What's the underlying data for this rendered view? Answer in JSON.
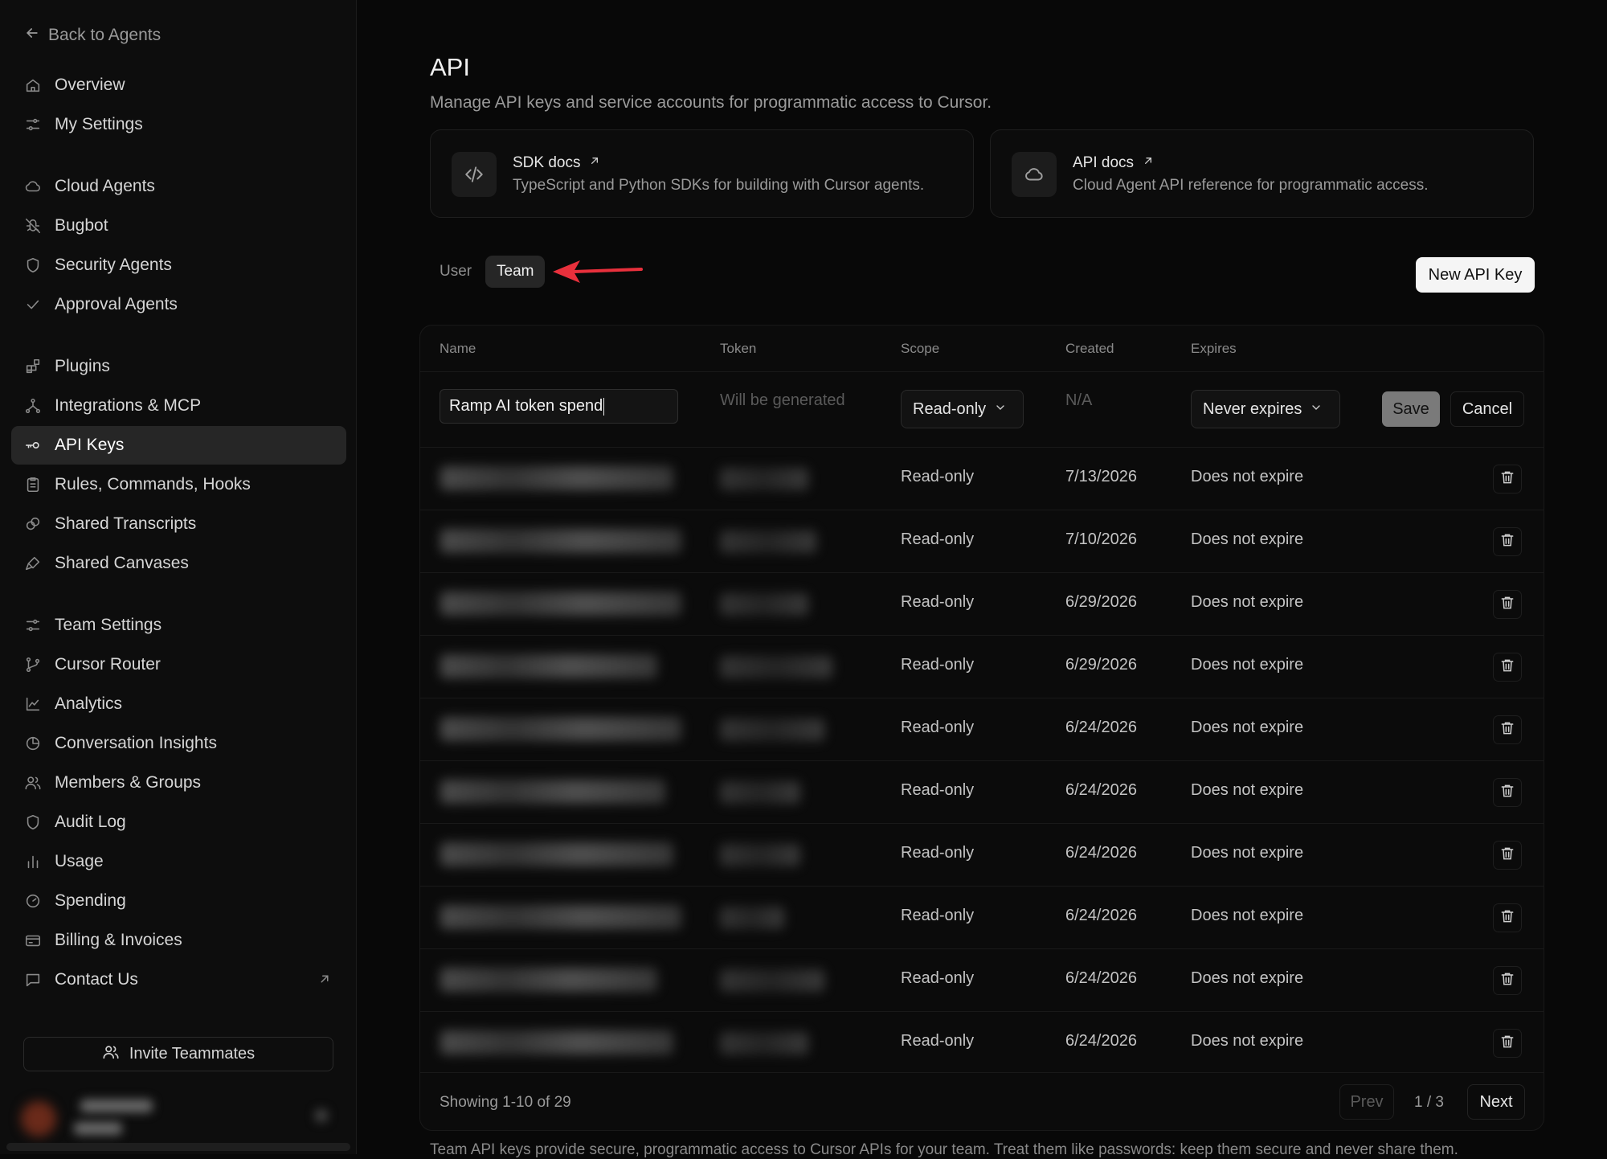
{
  "sidebar": {
    "back_label": "Back to Agents",
    "items": [
      {
        "label": "Overview",
        "icon": "home-icon"
      },
      {
        "label": "My Settings",
        "icon": "sliders-icon"
      },
      {
        "label": "Cloud Agents",
        "icon": "cloud-icon"
      },
      {
        "label": "Bugbot",
        "icon": "bug-off-icon"
      },
      {
        "label": "Security Agents",
        "icon": "shield-icon"
      },
      {
        "label": "Approval Agents",
        "icon": "check-icon"
      },
      {
        "label": "Plugins",
        "icon": "blocks-icon"
      },
      {
        "label": "Integrations & MCP",
        "icon": "network-icon"
      },
      {
        "label": "API Keys",
        "icon": "key-icon"
      },
      {
        "label": "Rules, Commands, Hooks",
        "icon": "clipboard-icon"
      },
      {
        "label": "Shared Transcripts",
        "icon": "chat-share-icon"
      },
      {
        "label": "Shared Canvases",
        "icon": "brush-icon"
      },
      {
        "label": "Team Settings",
        "icon": "sliders-icon"
      },
      {
        "label": "Cursor Router",
        "icon": "branch-icon"
      },
      {
        "label": "Analytics",
        "icon": "line-chart-icon"
      },
      {
        "label": "Conversation Insights",
        "icon": "pie-icon"
      },
      {
        "label": "Members & Groups",
        "icon": "users-icon"
      },
      {
        "label": "Audit Log",
        "icon": "shield-icon"
      },
      {
        "label": "Usage",
        "icon": "bar-chart-icon"
      },
      {
        "label": "Spending",
        "icon": "gauge-icon"
      },
      {
        "label": "Billing & Invoices",
        "icon": "card-icon"
      },
      {
        "label": "Contact Us",
        "icon": "message-icon"
      }
    ],
    "active": "API Keys",
    "invite_label": "Invite Teammates"
  },
  "header": {
    "title": "API",
    "subtitle": "Manage API keys and service accounts for programmatic access to Cursor."
  },
  "cards": [
    {
      "title": "SDK docs",
      "desc": "TypeScript and Python SDKs for building with Cursor agents.",
      "icon": "code-icon"
    },
    {
      "title": "API docs",
      "desc": "Cloud Agent API reference for programmatic access.",
      "icon": "cloud-icon"
    }
  ],
  "toggle": {
    "user": "User",
    "team": "Team",
    "selected": "Team"
  },
  "new_key_label": "New API Key",
  "table": {
    "headers": {
      "name": "Name",
      "token": "Token",
      "scope": "Scope",
      "created": "Created",
      "expires": "Expires"
    },
    "new_row": {
      "name_value": "Ramp AI token spend",
      "token_placeholder": "Will be generated",
      "scope": "Read-only",
      "created": "N/A",
      "expires": "Never expires",
      "save": "Save",
      "cancel": "Cancel"
    },
    "rows": [
      {
        "scope": "Read-only",
        "created": "7/13/2026",
        "expires": "Does not expire"
      },
      {
        "scope": "Read-only",
        "created": "7/10/2026",
        "expires": "Does not expire"
      },
      {
        "scope": "Read-only",
        "created": "6/29/2026",
        "expires": "Does not expire"
      },
      {
        "scope": "Read-only",
        "created": "6/29/2026",
        "expires": "Does not expire"
      },
      {
        "scope": "Read-only",
        "created": "6/24/2026",
        "expires": "Does not expire"
      },
      {
        "scope": "Read-only",
        "created": "6/24/2026",
        "expires": "Does not expire"
      },
      {
        "scope": "Read-only",
        "created": "6/24/2026",
        "expires": "Does not expire"
      },
      {
        "scope": "Read-only",
        "created": "6/24/2026",
        "expires": "Does not expire"
      },
      {
        "scope": "Read-only",
        "created": "6/24/2026",
        "expires": "Does not expire"
      },
      {
        "scope": "Read-only",
        "created": "6/24/2026",
        "expires": "Does not expire"
      }
    ]
  },
  "pagination": {
    "showing": "Showing 1-10 of 29",
    "prev": "Prev",
    "page": "1 / 3",
    "next": "Next"
  },
  "footer_note": "Team API keys provide secure, programmatic access to Cursor APIs for your team. Treat them like passwords: keep them secure and never share them.",
  "colors": {
    "accent_arrow": "#e8303c",
    "active_bg": "#262626",
    "background": "#080808"
  }
}
